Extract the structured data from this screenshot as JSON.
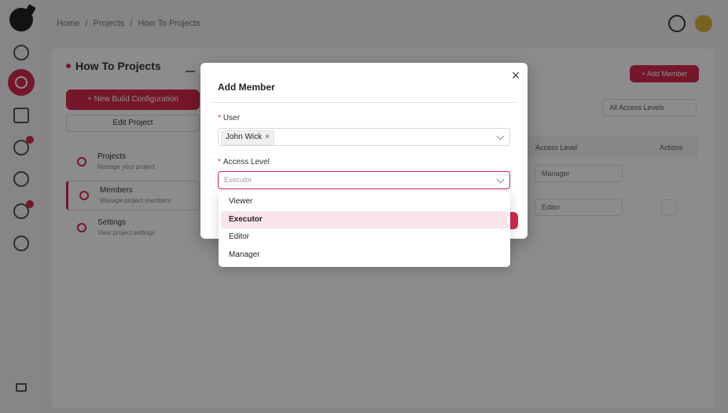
{
  "breadcrumb": {
    "home": "Home",
    "projects": "Projects",
    "current": "How To Projects",
    "separator": "/"
  },
  "project": {
    "title": "How To Projects"
  },
  "actions": {
    "add_member": "+ Add Member",
    "new_config": "+ New Build Configuration",
    "edit_project": "Edit Project"
  },
  "nav": [
    {
      "title": "Projects",
      "subtitle": "Manage your project"
    },
    {
      "title": "Members",
      "subtitle": "Manage project members"
    },
    {
      "title": "Settings",
      "subtitle": "View project settings"
    }
  ],
  "filter": {
    "value": "All Access Levels"
  },
  "table": {
    "headers": {
      "access_level": "Access Level",
      "actions": "Actions"
    },
    "rows": [
      {
        "access_level": "Manager"
      },
      {
        "access_level": "Editor"
      }
    ]
  },
  "modal": {
    "title": "Add Member",
    "close_icon": "×",
    "user": {
      "label": "User",
      "required_mark": "*",
      "tag": "John Wick",
      "tag_remove": "×"
    },
    "access_level": {
      "label": "Access Level",
      "required_mark": "*",
      "placeholder": "Executor"
    }
  },
  "dropdown": {
    "options": [
      "Viewer",
      "Executor",
      "Editor",
      "Manager"
    ],
    "selected": "Executor"
  },
  "colors": {
    "accent": "#d7294f",
    "overlay": "rgba(0,0,0,0.45)",
    "selected_option_bg": "#f9e4ea"
  },
  "icons": {
    "sidebar": [
      "logo-icon",
      "dashboard-icon",
      "projects-icon",
      "monitor-icon",
      "build-icon",
      "deploy-icon",
      "alerts-icon",
      "settings-icon",
      "collapse-icon"
    ],
    "top": [
      "clock-icon",
      "user-avatar"
    ]
  }
}
